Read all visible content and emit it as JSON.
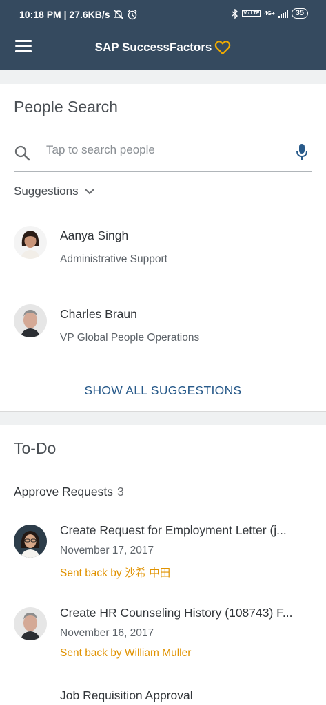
{
  "status_bar": {
    "time_info": "10:18 PM | 27.6KB/s",
    "network": "4G+",
    "volte": "Vo LTE",
    "battery": "35"
  },
  "header": {
    "title": "SAP SuccessFactors",
    "menu_icon": "hamburger-menu-icon",
    "brand_icon": "heart-outline-icon",
    "colors": {
      "background": "#354a5f",
      "brand_accent": "#f0ab00"
    }
  },
  "people_search": {
    "title": "People Search",
    "search_placeholder": "Tap to search people",
    "suggestions_label": "Suggestions",
    "people": [
      {
        "name": "Aanya Singh",
        "role": "Administrative Support"
      },
      {
        "name": "Charles Braun",
        "role": "VP Global People Operations"
      }
    ],
    "show_all_label": "SHOW ALL SUGGESTIONS"
  },
  "todo": {
    "title": "To-Do",
    "approve_label": "Approve Requests",
    "approve_count": "3",
    "items": [
      {
        "title": "Create Request for Employment Letter (j...",
        "date": "November 17, 2017",
        "status": "Sent back by 沙希 中田"
      },
      {
        "title": "Create HR Counseling History (108743) F...",
        "date": "November 16, 2017",
        "status": "Sent back by William Muller"
      },
      {
        "title": "Job Requisition Approval",
        "date": "",
        "status": ""
      }
    ]
  }
}
